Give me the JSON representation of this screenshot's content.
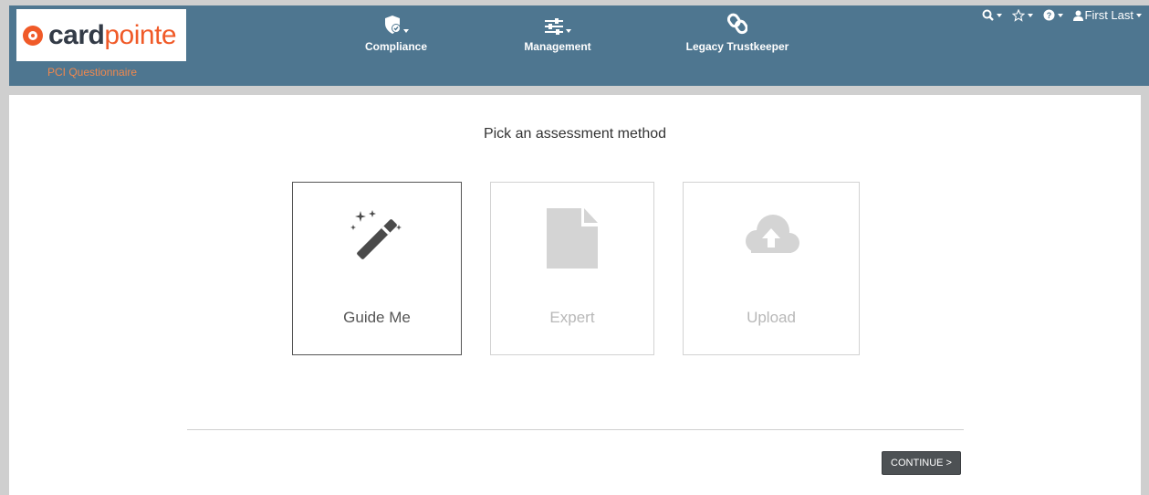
{
  "header": {
    "logo": {
      "card": "card",
      "pointe": "pointe"
    },
    "subtitle": "PCI Questionnaire",
    "nav": [
      {
        "label": "Compliance",
        "icon": "shield-check-icon"
      },
      {
        "label": "Management",
        "icon": "sliders-icon"
      },
      {
        "label": "Legacy Trustkeeper",
        "icon": "link-icon"
      }
    ],
    "user_menu": {
      "name": "First Last"
    }
  },
  "main": {
    "prompt": "Pick an assessment method",
    "options": [
      {
        "label": "Guide Me",
        "icon": "magic-wand-icon",
        "selected": true
      },
      {
        "label": "Expert",
        "icon": "document-icon",
        "selected": false
      },
      {
        "label": "Upload",
        "icon": "cloud-upload-icon",
        "selected": false
      }
    ],
    "continue_label": "CONTINUE >"
  },
  "colors": {
    "header_bg": "#4e7690",
    "brand_orange": "#f05a28",
    "subtitle_orange": "#f0884e",
    "button_bg": "#4d5154"
  }
}
